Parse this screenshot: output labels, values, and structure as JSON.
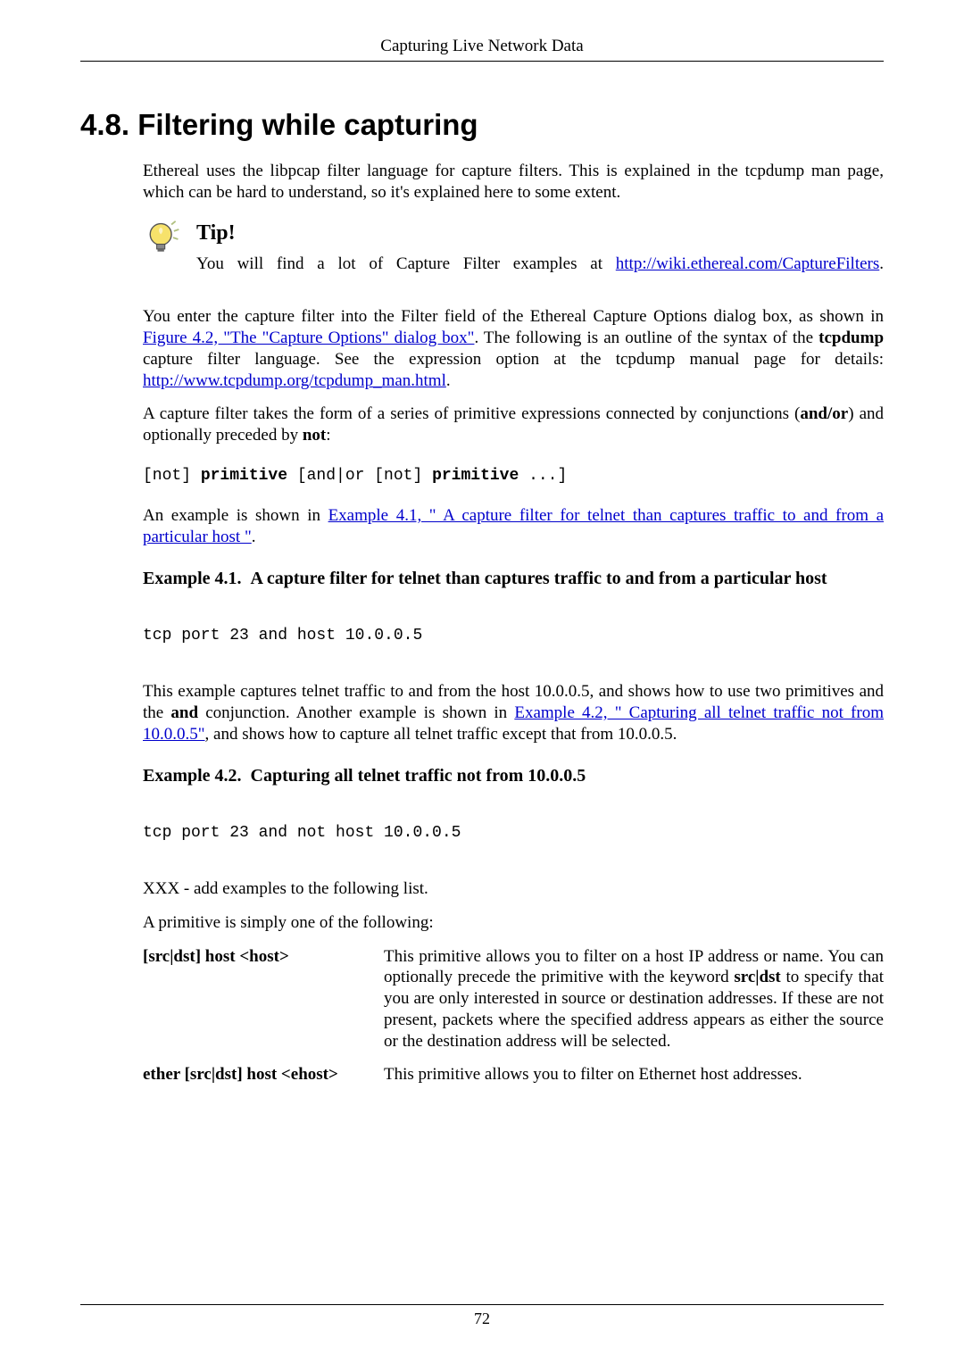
{
  "running_head": "Capturing Live Network Data",
  "section_title": "4.8. Filtering while capturing",
  "intro": "Ethereal uses the libpcap filter language for capture filters. This is explained in the tcpdump man page, which can be hard to understand, so it's explained here to some extent.",
  "tip": {
    "title": "Tip!",
    "pre": "You will find a lot of Capture Filter examples at ",
    "link_text": "http://wiki.ethereal.com/CaptureFilters",
    "post": "."
  },
  "para2": {
    "t1": "You enter the capture filter into the Filter field of the Ethereal Capture Options dialog box, as shown in ",
    "link1": "Figure 4.2, \"The \"Capture Options\" dialog box\"",
    "t2": ". The following is an outline of the syntax of the ",
    "bold1": "tcpdump",
    "t3": " capture filter language. See the expression option at the tcpdump manual page for details: ",
    "link2": "http://www.tcpdump.org/tcpdump_man.html",
    "t4": "."
  },
  "para3": {
    "t1": "A capture filter takes the form of a series of primitive expressions connected by conjunctions (",
    "b1": "and/or",
    "t2": ") and optionally preceded by ",
    "b2": "not",
    "t3": ":"
  },
  "code1": {
    "c1": "[not] ",
    "b1": "primitive",
    "c2": " [and|or [not] ",
    "b2": "primitive",
    "c3": " ...]"
  },
  "para4": {
    "t1": "An example is shown in ",
    "link": "Example 4.1, \" A capture filter for telnet than captures traffic to and from a particular host \"",
    "t2": "."
  },
  "ex1_title": "Example 4.1.  A capture filter for telnet than captures traffic to and from a particular host",
  "code2": "tcp port 23 and host 10.0.0.5",
  "para5": {
    "t1": "This example captures telnet traffic to and from the host 10.0.0.5, and shows how to use two primitives and the ",
    "b1": "and",
    "t2": " conjunction. Another example is shown in ",
    "link": "Example 4.2, \" Capturing all telnet traffic not from 10.0.0.5\"",
    "t3": ", and shows how to capture all telnet traffic except that from 10.0.0.5."
  },
  "ex2_title": "Example 4.2.  Capturing all telnet traffic not from 10.0.0.5",
  "code3": "tcp port 23 and not host 10.0.0.5",
  "para6": "XXX - add examples to the following list.",
  "para7": "A primitive is simply one of the following:",
  "prim1": {
    "term": "[src|dst] host <host>",
    "d1": "This primitive allows you to filter on a host IP address or name. You can optionally precede the primitive with the keyword ",
    "b1": "src|dst",
    "d2": " to specify that you are only interested in source or destination addresses. If these are not present, packets where the specified address appears as either the source or the destination address will be selected."
  },
  "prim2": {
    "term": "ether [src|dst] host <ehost>",
    "d1": "This primitive allows you to filter on Ethernet host addresses."
  },
  "page_number": "72"
}
